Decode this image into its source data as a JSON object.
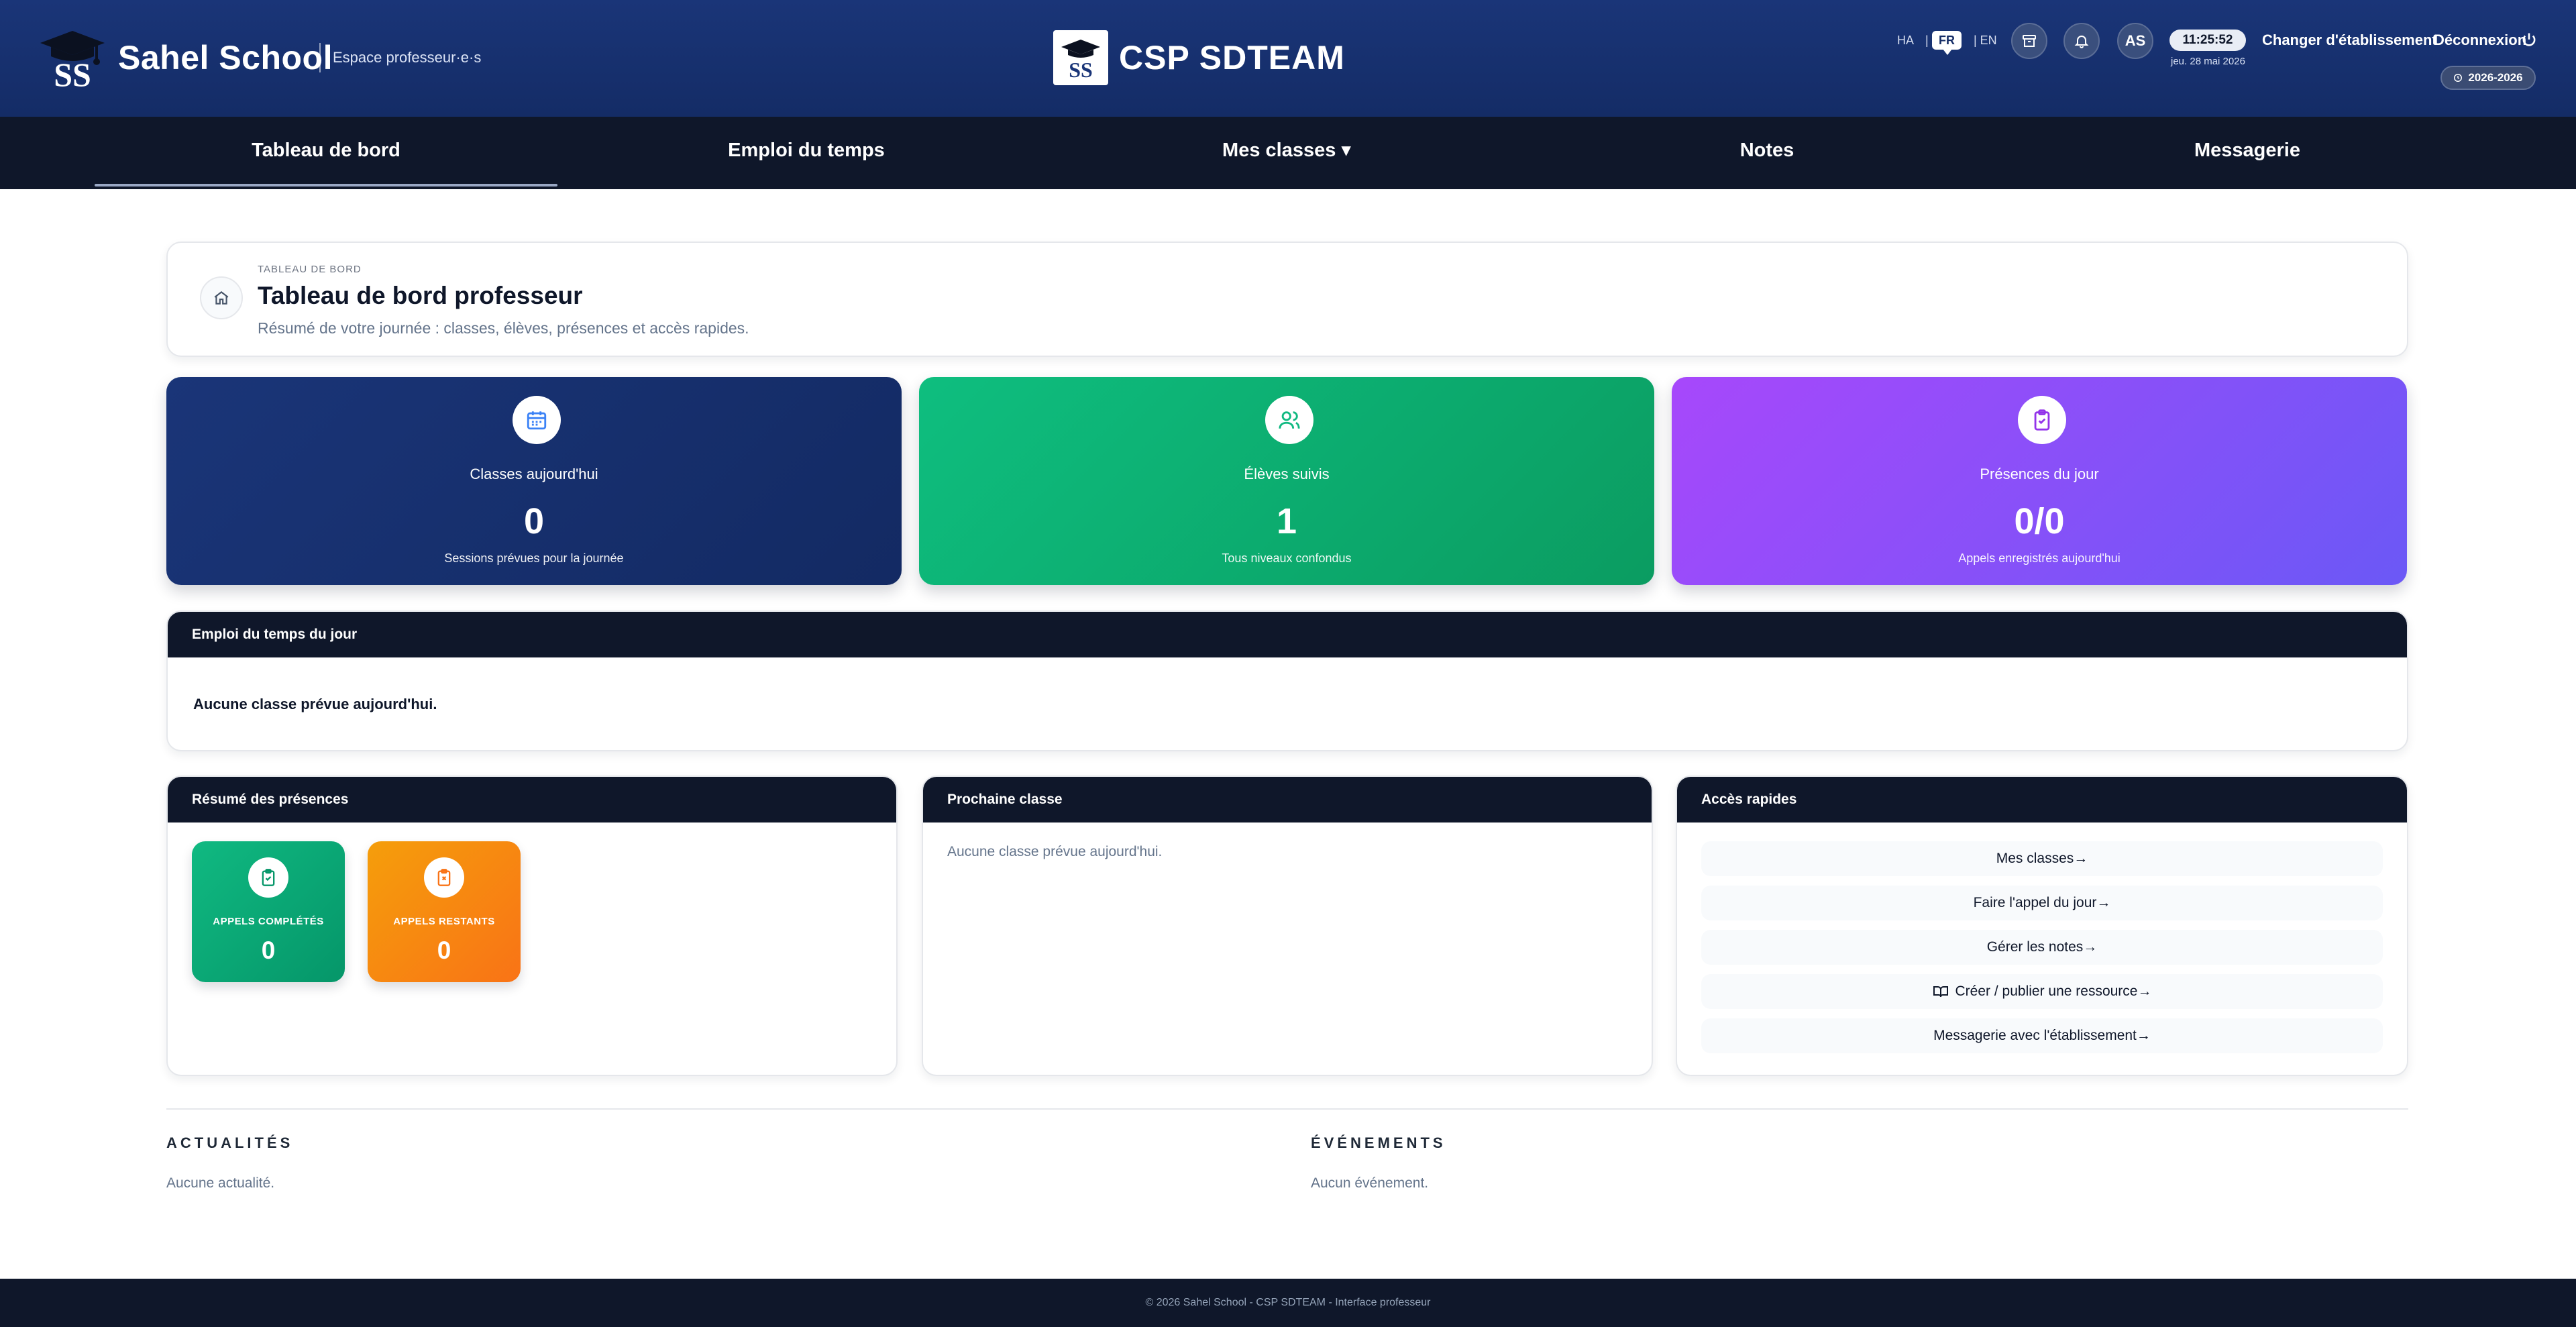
{
  "header": {
    "school_name": "Sahel School",
    "space_label": "Espace professeur·e·s",
    "center_name": "CSP SDTEAM",
    "languages": {
      "ha": "HA",
      "sep": "|",
      "fr": "FR",
      "en": "| EN",
      "active": "FR"
    },
    "avatar_initials": "AS",
    "clock": "11:25:52",
    "date": "jeu. 28 mai 2026",
    "change_etab": "Changer d'établissement",
    "logout": "Déconnexion",
    "school_year": "2026-2026",
    "icons": {
      "archive": "archive-icon",
      "bell": "bell-icon",
      "logout": "power-icon",
      "year": "clock-icon"
    }
  },
  "nav": {
    "items": [
      {
        "label": "Tableau de bord",
        "active": true
      },
      {
        "label": "Emploi du temps",
        "active": false
      },
      {
        "label": "Mes classes ▾",
        "active": false
      },
      {
        "label": "Notes",
        "active": false
      },
      {
        "label": "Messagerie",
        "active": false
      }
    ]
  },
  "title_card": {
    "breadcrumb": "TABLEAU DE BORD",
    "title": "Tableau de bord professeur",
    "subtitle": "Résumé de votre journée : classes, élèves, présences et accès rapides."
  },
  "stats": [
    {
      "label": "Classes aujourd'hui",
      "value": "0",
      "note": "Sessions prévues pour la journée",
      "icon": "calendar-icon",
      "color": "#1a3578"
    },
    {
      "label": "Élèves suivis",
      "value": "1",
      "note": "Tous niveaux confondus",
      "icon": "users-icon",
      "color": "#0ebe7f"
    },
    {
      "label": "Présences du jour",
      "value": "0/0",
      "note": "Appels enregistrés aujourd'hui",
      "icon": "clipboard-check-icon",
      "color": "#a748fb"
    }
  ],
  "schedule": {
    "title": "Emploi du temps du jour",
    "empty": "Aucune classe prévue aujourd'hui."
  },
  "attendance": {
    "title": "Résumé des présences",
    "completed": {
      "label": "APPELS COMPLÉTÉS",
      "value": "0",
      "color": "#10b981"
    },
    "remaining": {
      "label": "APPELS RESTANTS",
      "value": "0",
      "color": "#f59e0b"
    }
  },
  "next_class": {
    "title": "Prochaine classe",
    "empty": "Aucune classe prévue aujourd'hui."
  },
  "quick_access": {
    "title": "Accès rapides",
    "links": [
      "Mes classes→",
      "Faire l'appel du jour→",
      "Gérer les notes→",
      "Créer / publier une ressource→",
      "Messagerie avec l'établissement→"
    ]
  },
  "news": {
    "title": "ACTUALITÉS",
    "empty": "Aucune actualité."
  },
  "events": {
    "title": "ÉVÉNEMENTS",
    "empty": "Aucun événement."
  },
  "footer": {
    "text": "© 2026 Sahel School - CSP SDTEAM - Interface professeur"
  },
  "colors": {
    "header": "#1a3578",
    "nav": "#0f172a",
    "accent_green": "#0ebe7f",
    "accent_purple": "#a748fb",
    "accent_orange": "#f59e0b"
  }
}
